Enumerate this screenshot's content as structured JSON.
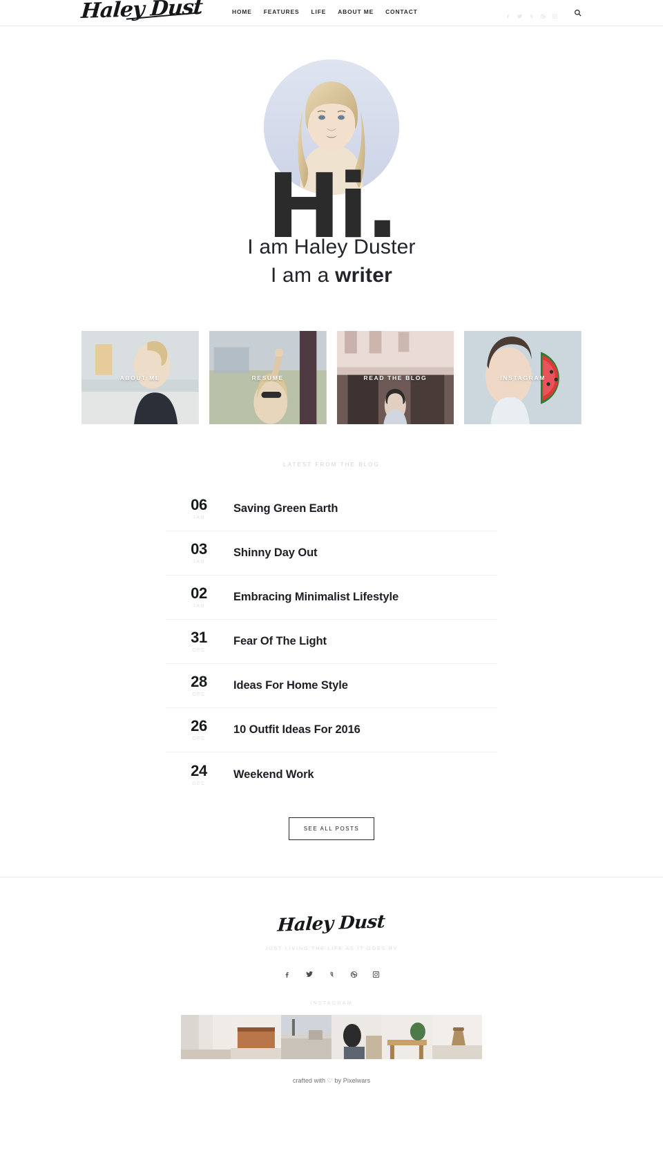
{
  "site": {
    "brand": "Haley Dust",
    "footer_brand": "Haley Dust",
    "tagline": "JUST LIVING THE LIFE AS IT GOES BY"
  },
  "header": {
    "nav": [
      {
        "label": "HOME"
      },
      {
        "label": "FEATURES"
      },
      {
        "label": "LIFE"
      },
      {
        "label": "ABOUT ME"
      },
      {
        "label": "CONTACT"
      }
    ],
    "social": [
      {
        "name": "facebook-icon"
      },
      {
        "name": "twitter-icon"
      },
      {
        "name": "vine-icon"
      },
      {
        "name": "dribbble-icon"
      },
      {
        "name": "instagram-icon"
      }
    ],
    "search_label": "Search"
  },
  "hero": {
    "hi": "Hi.",
    "line1": "I am Haley Duster",
    "line2_prefix": "I am a ",
    "line2_strong": "writer"
  },
  "tiles": [
    {
      "label": "ABOUT ME"
    },
    {
      "label": "RESUME"
    },
    {
      "label": "READ THE BLOG"
    },
    {
      "label": "INSTAGRAM"
    }
  ],
  "blog": {
    "kicker": "LATEST FROM THE BLOG",
    "posts": [
      {
        "day": "06",
        "month": "JAN",
        "title": "Saving Green Earth"
      },
      {
        "day": "03",
        "month": "JAN",
        "title": "Shinny Day Out"
      },
      {
        "day": "02",
        "month": "JAN",
        "title": "Embracing Minimalist Lifestyle"
      },
      {
        "day": "31",
        "month": "DEC",
        "title": "Fear Of The Light"
      },
      {
        "day": "28",
        "month": "DEC",
        "title": "Ideas For Home Style"
      },
      {
        "day": "26",
        "month": "DEC",
        "title": "10 Outfit Ideas For 2016"
      },
      {
        "day": "24",
        "month": "DEC",
        "title": "Weekend Work"
      }
    ],
    "see_all_label": "SEE ALL POSTS"
  },
  "footer": {
    "social": [
      {
        "name": "facebook-icon"
      },
      {
        "name": "twitter-icon"
      },
      {
        "name": "vine-icon"
      },
      {
        "name": "dribbble-icon"
      },
      {
        "name": "instagram-icon"
      }
    ],
    "instagram_kicker": "INSTAGRAM",
    "instagram_count": 6,
    "credit_before": "crafted with",
    "credit_heart": "♡",
    "credit_after": "by Pixelwars"
  },
  "colors": {
    "text": "#1c1f25",
    "muted": "#d3d3d3",
    "divider": "#f1f1f1",
    "portrait_bg": "#d7dcea"
  }
}
